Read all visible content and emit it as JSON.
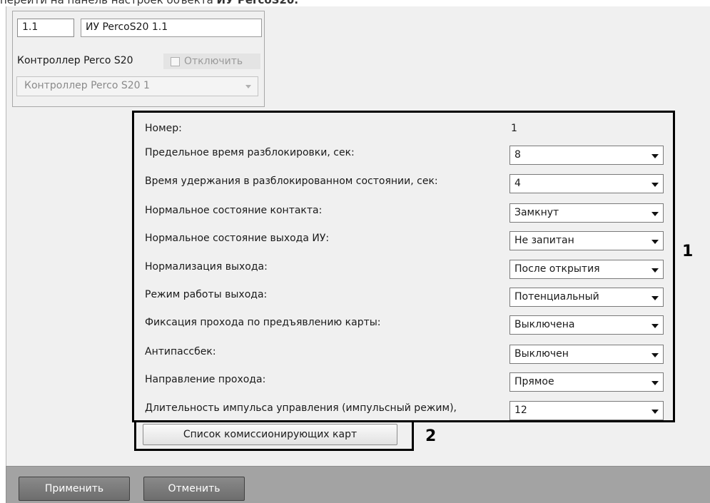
{
  "caption": {
    "text_before": "перейти на панель настроек объекта ",
    "text_bold": "ИУ PercoS20."
  },
  "object_header": {
    "id": "1.1",
    "name": "ИУ PercoS20 1.1",
    "parent_label": "Контроллер Perco S20",
    "disable_label": "Отключить",
    "disable_checked": false,
    "parent_selected": "Контроллер Perco S20 1"
  },
  "settings": {
    "number_label": "Номер:",
    "number_value": "1",
    "rows": [
      {
        "label": "Предельное время разблокировки, сек:",
        "value": "8"
      },
      {
        "label": "Время удержания в разблокированном состоянии, сек:",
        "value": "4"
      },
      {
        "label": "Нормальное состояние контакта:",
        "value": "Замкнут"
      },
      {
        "label": "Нормальное состояние выхода ИУ:",
        "value": "Не запитан"
      },
      {
        "label": "Нормализация выхода:",
        "value": "После открытия"
      },
      {
        "label": "Режим работы выхода:",
        "value": "Потенциальный"
      },
      {
        "label": "Фиксация прохода по предъявлению карты:",
        "value": "Выключена"
      },
      {
        "label": "Антипассбек:",
        "value": "Выключен"
      },
      {
        "label": "Направление прохода:",
        "value": "Прямое"
      },
      {
        "label": "Длительность импульса управления (импульсный режим),",
        "value": "12"
      }
    ]
  },
  "cards_button_label": "Список комиссионирующих карт",
  "callouts": {
    "one": "1",
    "two": "2"
  },
  "footer": {
    "apply_label": "Применить",
    "cancel_label": "Отменить"
  },
  "colors": {
    "panel_bg": "#f0f0f0",
    "footer_bg": "#a3a3a3",
    "highlight_border": "#000000"
  },
  "icons": {
    "dropdown_arrow": "chevron-down-icon",
    "checkbox": "checkbox-icon"
  }
}
